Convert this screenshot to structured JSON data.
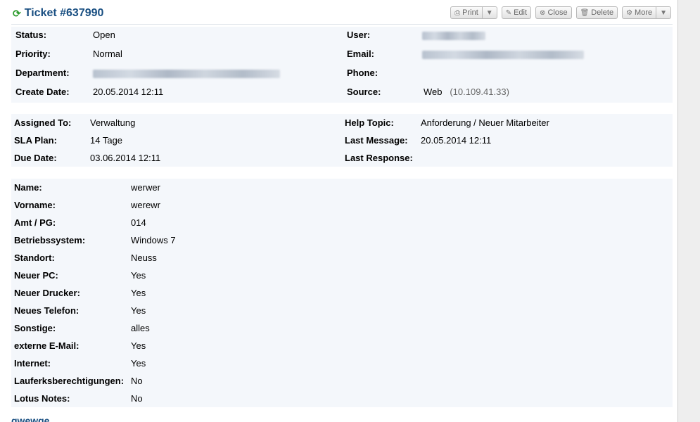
{
  "ticket": {
    "title": "Ticket #637990",
    "icon": "refresh-icon"
  },
  "toolbar": {
    "print": "Print",
    "edit": "Edit",
    "close": "Close",
    "delete": "Delete",
    "more": "More"
  },
  "info": {
    "status_label": "Status:",
    "status": "Open",
    "priority_label": "Priority:",
    "priority": "Normal",
    "department_label": "Department:",
    "create_date_label": "Create Date:",
    "create_date": "20.05.2014 12:11",
    "user_label": "User:",
    "email_label": "Email:",
    "phone_label": "Phone:",
    "source_label": "Source:",
    "source": "Web",
    "source_ip": "(10.109.41.33)"
  },
  "assignment": {
    "assigned_label": "Assigned To:",
    "assigned": "Verwaltung",
    "sla_label": "SLA Plan:",
    "sla": "14 Tage",
    "due_label": "Due Date:",
    "due": "03.06.2014 12:11",
    "topic_label": "Help Topic:",
    "topic": "Anforderung / Neuer Mitarbeiter",
    "last_msg_label": "Last Message:",
    "last_msg": "20.05.2014 12:11",
    "last_resp_label": "Last Response:"
  },
  "fields": [
    {
      "label": "Name:",
      "value": "werwer"
    },
    {
      "label": "Vorname:",
      "value": "werewr"
    },
    {
      "label": "Amt / PG:",
      "value": "014"
    },
    {
      "label": "Betriebssystem:",
      "value": "Windows 7"
    },
    {
      "label": "Standort:",
      "value": "Neuss"
    },
    {
      "label": "Neuer PC:",
      "value": "Yes"
    },
    {
      "label": "Neuer Drucker:",
      "value": "Yes"
    },
    {
      "label": "Neues Telefon:",
      "value": "Yes"
    },
    {
      "label": "Sonstige:",
      "value": "alles"
    },
    {
      "label": "externe E-Mail:",
      "value": "Yes"
    },
    {
      "label": "Internet:",
      "value": "Yes"
    },
    {
      "label": "Lauferksberechtigungen:",
      "value": "No"
    },
    {
      "label": "Lotus Notes:",
      "value": "No"
    }
  ],
  "footer": {
    "subject": "qwewqe"
  },
  "colors": {
    "link": "#184e81",
    "panel": "#f4f7fb",
    "refresh": "#2a9a2a"
  }
}
